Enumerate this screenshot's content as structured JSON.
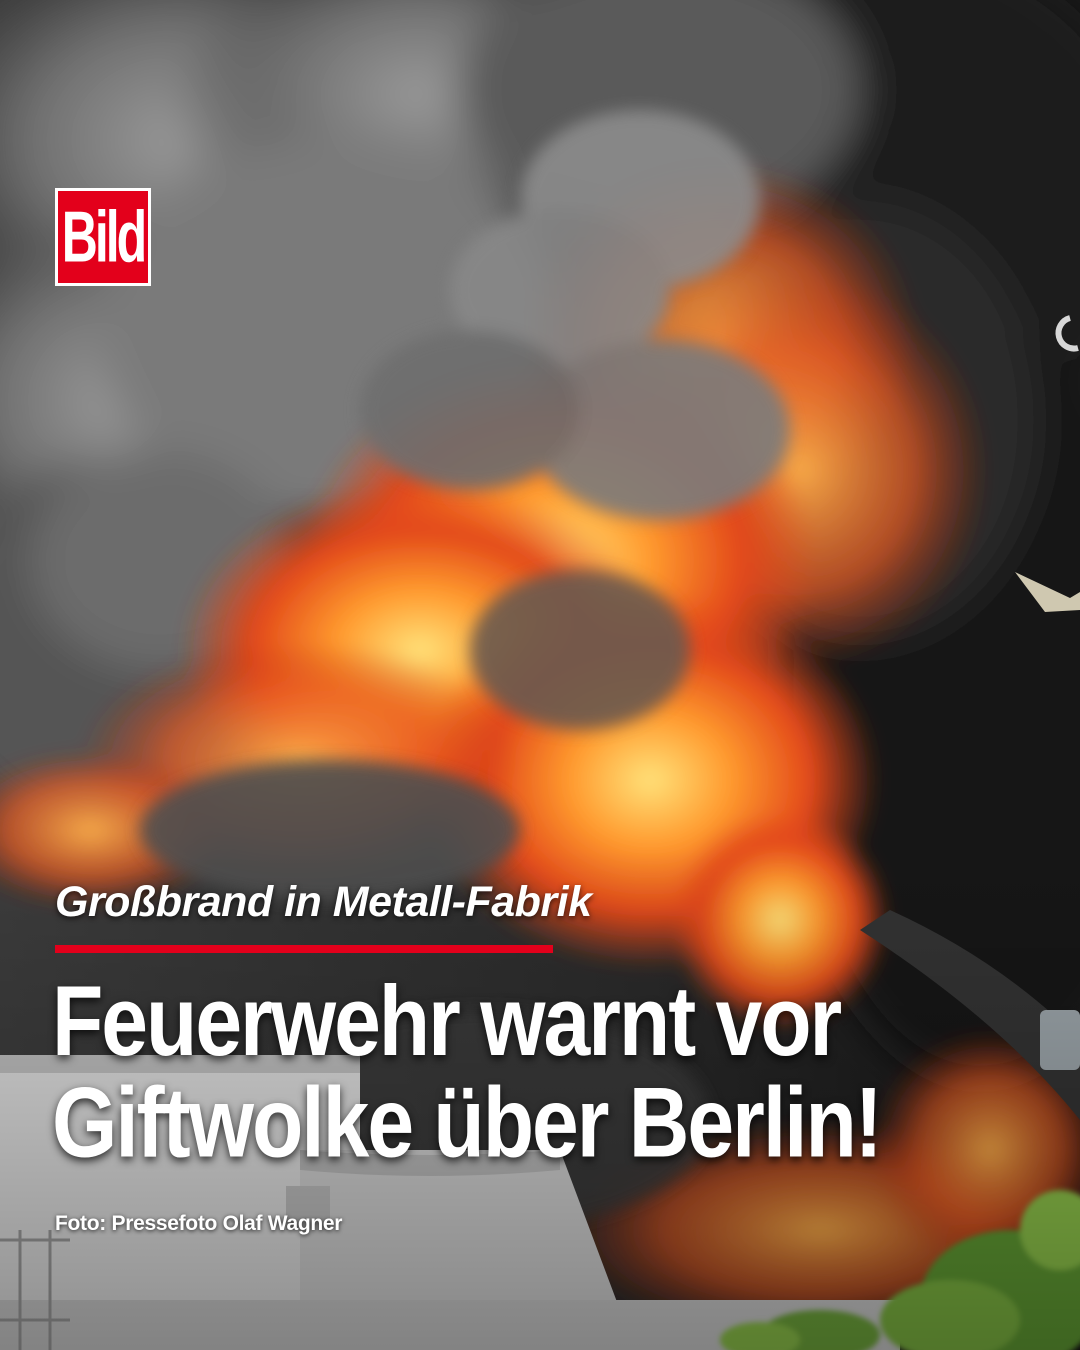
{
  "brand": {
    "logo_text": "Bild",
    "accent_color": "#e3001b"
  },
  "kicker": "Großbrand in Metall-Fabrik",
  "headline": {
    "line1": "Feuerwehr warnt vor",
    "line2": "Giftwolke über Berlin!"
  },
  "credit": "Foto: Pressefoto Olaf Wagner",
  "photo": {
    "subject": "fire-and-smoke"
  }
}
